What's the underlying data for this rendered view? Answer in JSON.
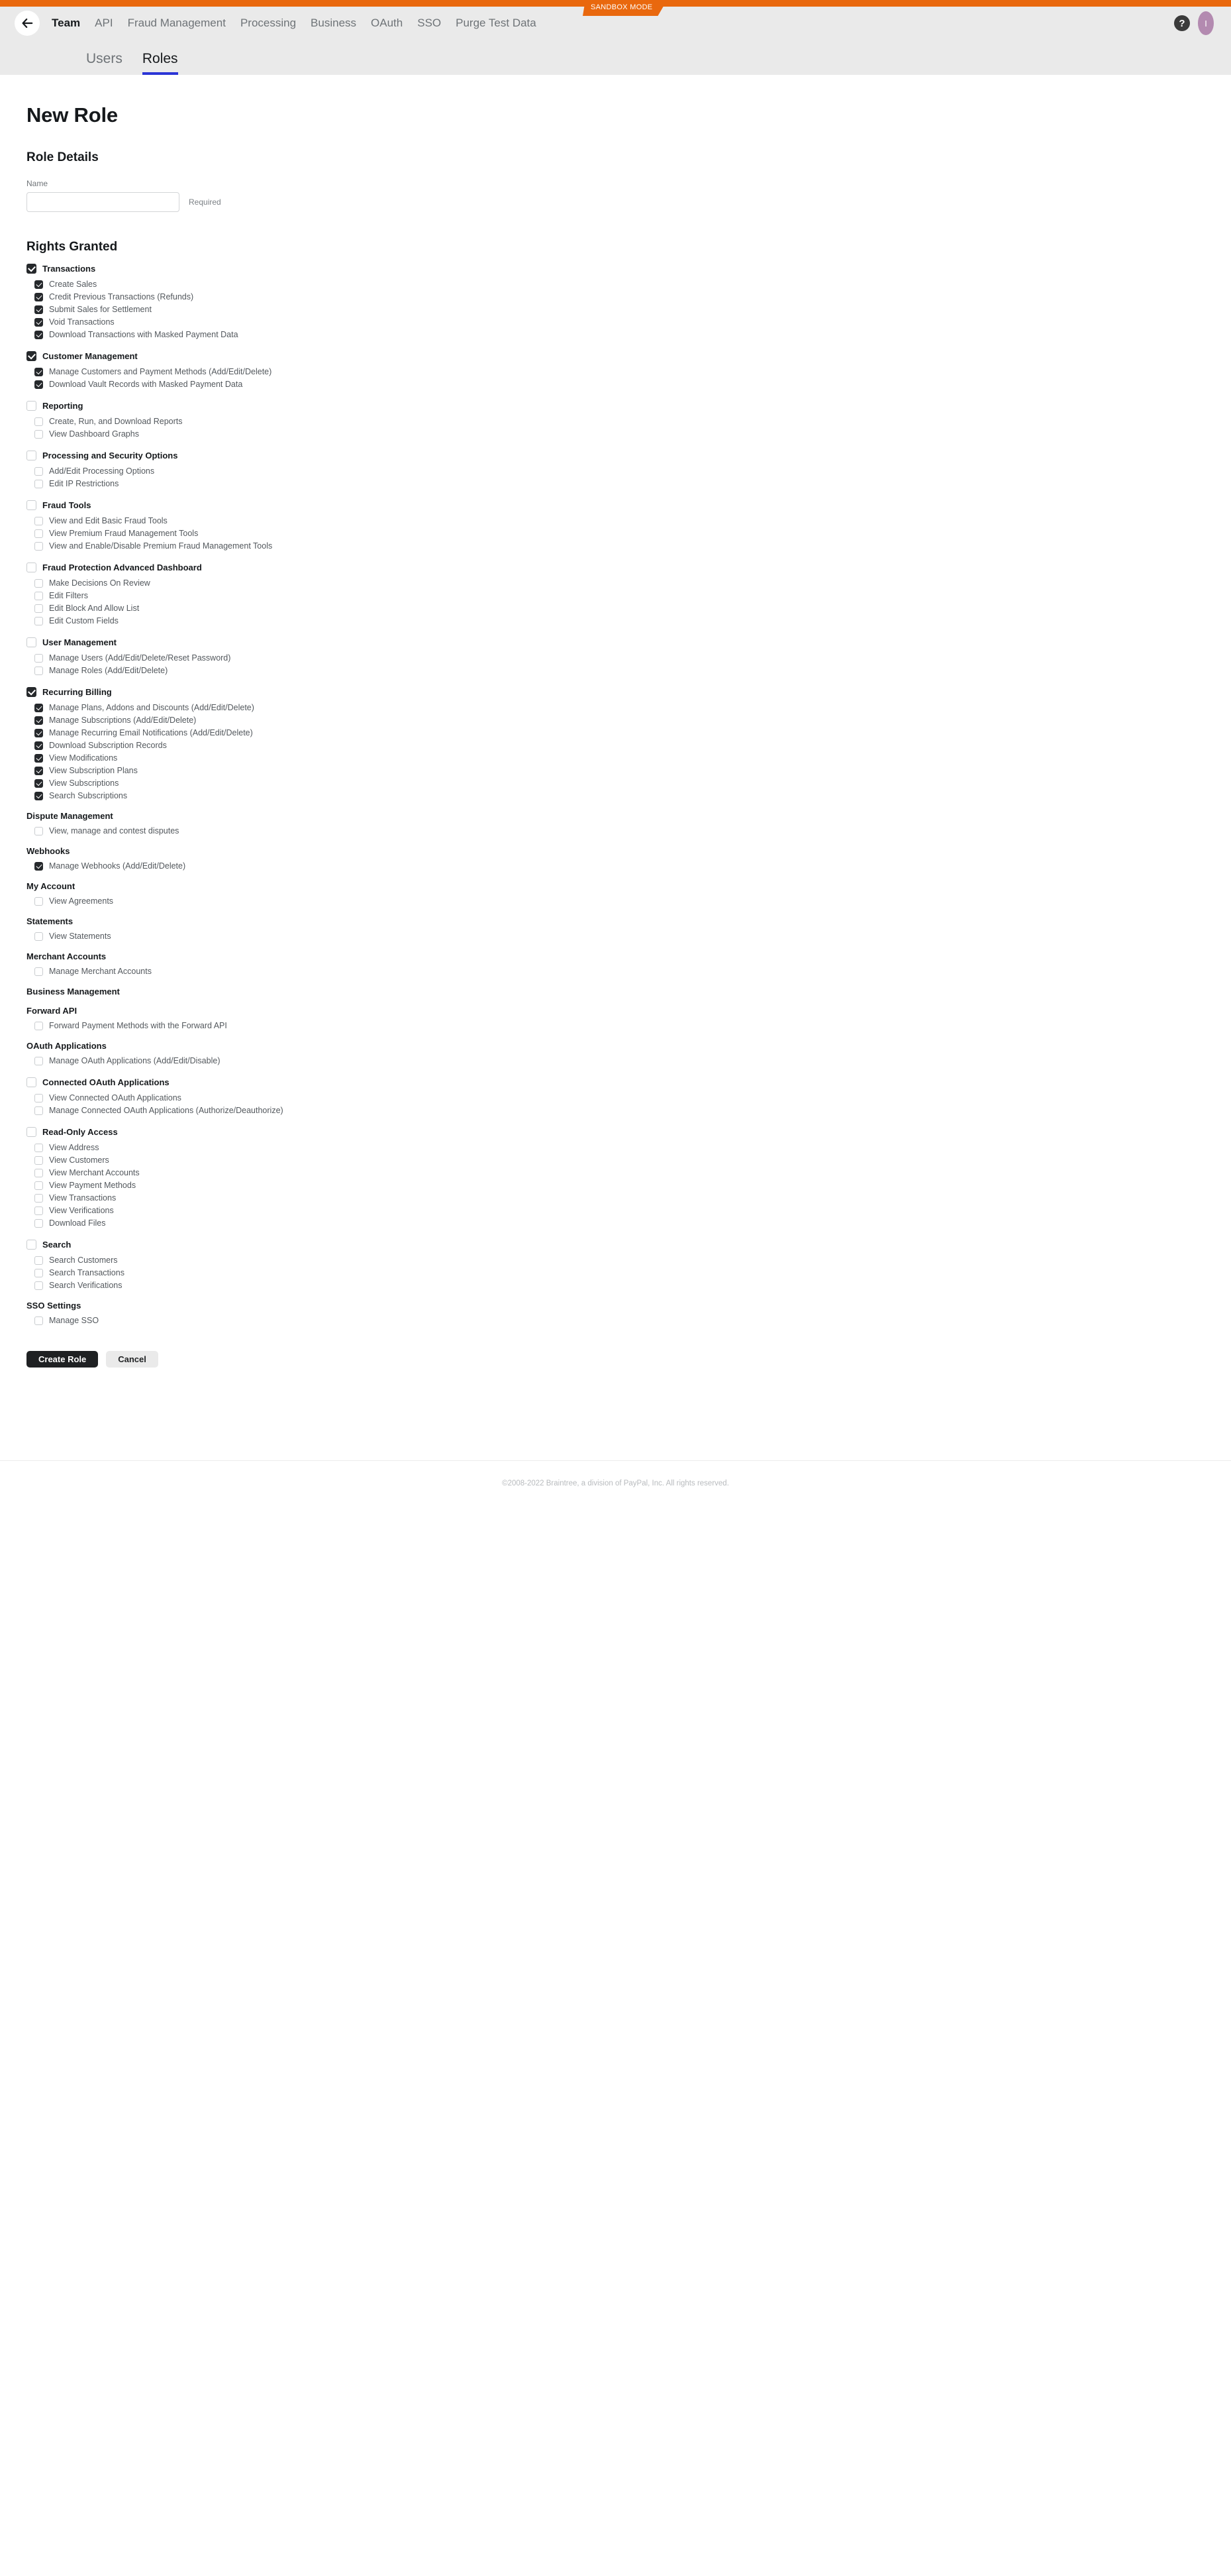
{
  "header": {
    "sandbox_badge": "SANDBOX MODE",
    "back_icon": "back-arrow-icon",
    "help_label": "?",
    "avatar_label": "I",
    "nav": [
      {
        "label": "Team",
        "active": true
      },
      {
        "label": "API",
        "active": false
      },
      {
        "label": "Fraud Management",
        "active": false
      },
      {
        "label": "Processing",
        "active": false
      },
      {
        "label": "Business",
        "active": false
      },
      {
        "label": "OAuth",
        "active": false
      },
      {
        "label": "SSO",
        "active": false
      },
      {
        "label": "Purge Test Data",
        "active": false
      }
    ],
    "tabs": [
      {
        "label": "Users",
        "active": false
      },
      {
        "label": "Roles",
        "active": true
      }
    ],
    "accent_blue": "#2b35d6",
    "accent_orange": "#e9680e"
  },
  "page": {
    "title": "New Role",
    "role_details_heading": "Role Details",
    "name_label": "Name",
    "name_value": "",
    "name_placeholder": "",
    "name_hint": "Required",
    "rights_heading": "Rights Granted"
  },
  "rights": [
    {
      "id": "transactions",
      "label": "Transactions",
      "has_parent_checkbox": true,
      "checked": true,
      "children": [
        {
          "label": "Create Sales",
          "checked": true
        },
        {
          "label": "Credit Previous Transactions (Refunds)",
          "checked": true
        },
        {
          "label": "Submit Sales for Settlement",
          "checked": true
        },
        {
          "label": "Void Transactions",
          "checked": true
        },
        {
          "label": "Download Transactions with Masked Payment Data",
          "checked": true
        }
      ]
    },
    {
      "id": "customer-management",
      "label": "Customer Management",
      "has_parent_checkbox": true,
      "checked": true,
      "children": [
        {
          "label": "Manage Customers and Payment Methods (Add/Edit/Delete)",
          "checked": true
        },
        {
          "label": "Download Vault Records with Masked Payment Data",
          "checked": true
        }
      ]
    },
    {
      "id": "reporting",
      "label": "Reporting",
      "has_parent_checkbox": true,
      "checked": false,
      "children": [
        {
          "label": "Create, Run, and Download Reports",
          "checked": false
        },
        {
          "label": "View Dashboard Graphs",
          "checked": false
        }
      ]
    },
    {
      "id": "processing-and-security-options",
      "label": "Processing and Security Options",
      "has_parent_checkbox": true,
      "checked": false,
      "children": [
        {
          "label": "Add/Edit Processing Options",
          "checked": false
        },
        {
          "label": "Edit IP Restrictions",
          "checked": false
        }
      ]
    },
    {
      "id": "fraud-tools",
      "label": "Fraud Tools",
      "has_parent_checkbox": true,
      "checked": false,
      "children": [
        {
          "label": "View and Edit Basic Fraud Tools",
          "checked": false
        },
        {
          "label": "View Premium Fraud Management Tools",
          "checked": false
        },
        {
          "label": "View and Enable/Disable Premium Fraud Management Tools",
          "checked": false
        }
      ]
    },
    {
      "id": "fraud-protection-advanced-dashboard",
      "label": "Fraud Protection Advanced Dashboard",
      "has_parent_checkbox": true,
      "checked": false,
      "children": [
        {
          "label": "Make Decisions On Review",
          "checked": false
        },
        {
          "label": "Edit Filters",
          "checked": false
        },
        {
          "label": "Edit Block And Allow List",
          "checked": false
        },
        {
          "label": "Edit Custom Fields",
          "checked": false
        }
      ]
    },
    {
      "id": "user-management",
      "label": "User Management",
      "has_parent_checkbox": true,
      "checked": false,
      "children": [
        {
          "label": "Manage Users (Add/Edit/Delete/Reset Password)",
          "checked": false
        },
        {
          "label": "Manage Roles (Add/Edit/Delete)",
          "checked": false
        }
      ]
    },
    {
      "id": "recurring-billing",
      "label": "Recurring Billing",
      "has_parent_checkbox": true,
      "checked": true,
      "children": [
        {
          "label": "Manage Plans, Addons and Discounts (Add/Edit/Delete)",
          "checked": true
        },
        {
          "label": "Manage Subscriptions (Add/Edit/Delete)",
          "checked": true
        },
        {
          "label": "Manage Recurring Email Notifications (Add/Edit/Delete)",
          "checked": true
        },
        {
          "label": "Download Subscription Records",
          "checked": true
        },
        {
          "label": "View Modifications",
          "checked": true
        },
        {
          "label": "View Subscription Plans",
          "checked": true
        },
        {
          "label": "View Subscriptions",
          "checked": true
        },
        {
          "label": "Search Subscriptions",
          "checked": true
        }
      ]
    },
    {
      "id": "dispute-management",
      "label": "Dispute Management",
      "has_parent_checkbox": false,
      "checked": false,
      "children": [
        {
          "label": "View, manage and contest disputes",
          "checked": false
        }
      ]
    },
    {
      "id": "webhooks",
      "label": "Webhooks",
      "has_parent_checkbox": false,
      "checked": false,
      "children": [
        {
          "label": "Manage Webhooks (Add/Edit/Delete)",
          "checked": true
        }
      ]
    },
    {
      "id": "my-account",
      "label": "My Account",
      "has_parent_checkbox": false,
      "checked": false,
      "children": [
        {
          "label": "View Agreements",
          "checked": false
        }
      ]
    },
    {
      "id": "statements",
      "label": "Statements",
      "has_parent_checkbox": false,
      "checked": false,
      "children": [
        {
          "label": "View Statements",
          "checked": false
        }
      ]
    },
    {
      "id": "merchant-accounts",
      "label": "Merchant Accounts",
      "has_parent_checkbox": false,
      "checked": false,
      "children": [
        {
          "label": "Manage Merchant Accounts",
          "checked": false
        }
      ]
    },
    {
      "id": "business-management",
      "label": "Business Management",
      "has_parent_checkbox": false,
      "checked": false,
      "children": []
    },
    {
      "id": "forward-api",
      "label": "Forward API",
      "has_parent_checkbox": false,
      "checked": false,
      "children": [
        {
          "label": "Forward Payment Methods with the Forward API",
          "checked": false
        }
      ]
    },
    {
      "id": "oauth-applications",
      "label": "OAuth Applications",
      "has_parent_checkbox": false,
      "checked": false,
      "children": [
        {
          "label": "Manage OAuth Applications (Add/Edit/Disable)",
          "checked": false
        }
      ]
    },
    {
      "id": "connected-oauth-applications",
      "label": "Connected OAuth Applications",
      "has_parent_checkbox": true,
      "checked": false,
      "children": [
        {
          "label": "View Connected OAuth Applications",
          "checked": false
        },
        {
          "label": "Manage Connected OAuth Applications (Authorize/Deauthorize)",
          "checked": false
        }
      ]
    },
    {
      "id": "read-only-access",
      "label": "Read-Only Access",
      "has_parent_checkbox": true,
      "checked": false,
      "children": [
        {
          "label": "View Address",
          "checked": false
        },
        {
          "label": "View Customers",
          "checked": false
        },
        {
          "label": "View Merchant Accounts",
          "checked": false
        },
        {
          "label": "View Payment Methods",
          "checked": false
        },
        {
          "label": "View Transactions",
          "checked": false
        },
        {
          "label": "View Verifications",
          "checked": false
        },
        {
          "label": "Download Files",
          "checked": false
        }
      ]
    },
    {
      "id": "search",
      "label": "Search",
      "has_parent_checkbox": true,
      "checked": false,
      "children": [
        {
          "label": "Search Customers",
          "checked": false
        },
        {
          "label": "Search Transactions",
          "checked": false
        },
        {
          "label": "Search Verifications",
          "checked": false
        }
      ]
    },
    {
      "id": "sso-settings",
      "label": "SSO Settings",
      "has_parent_checkbox": false,
      "checked": false,
      "children": [
        {
          "label": "Manage SSO",
          "checked": false
        }
      ]
    }
  ],
  "actions": {
    "submit_label": "Create Role",
    "cancel_label": "Cancel"
  },
  "footer": {
    "copyright": "©2008-2022 Braintree, a division of PayPal, Inc. All rights reserved."
  }
}
